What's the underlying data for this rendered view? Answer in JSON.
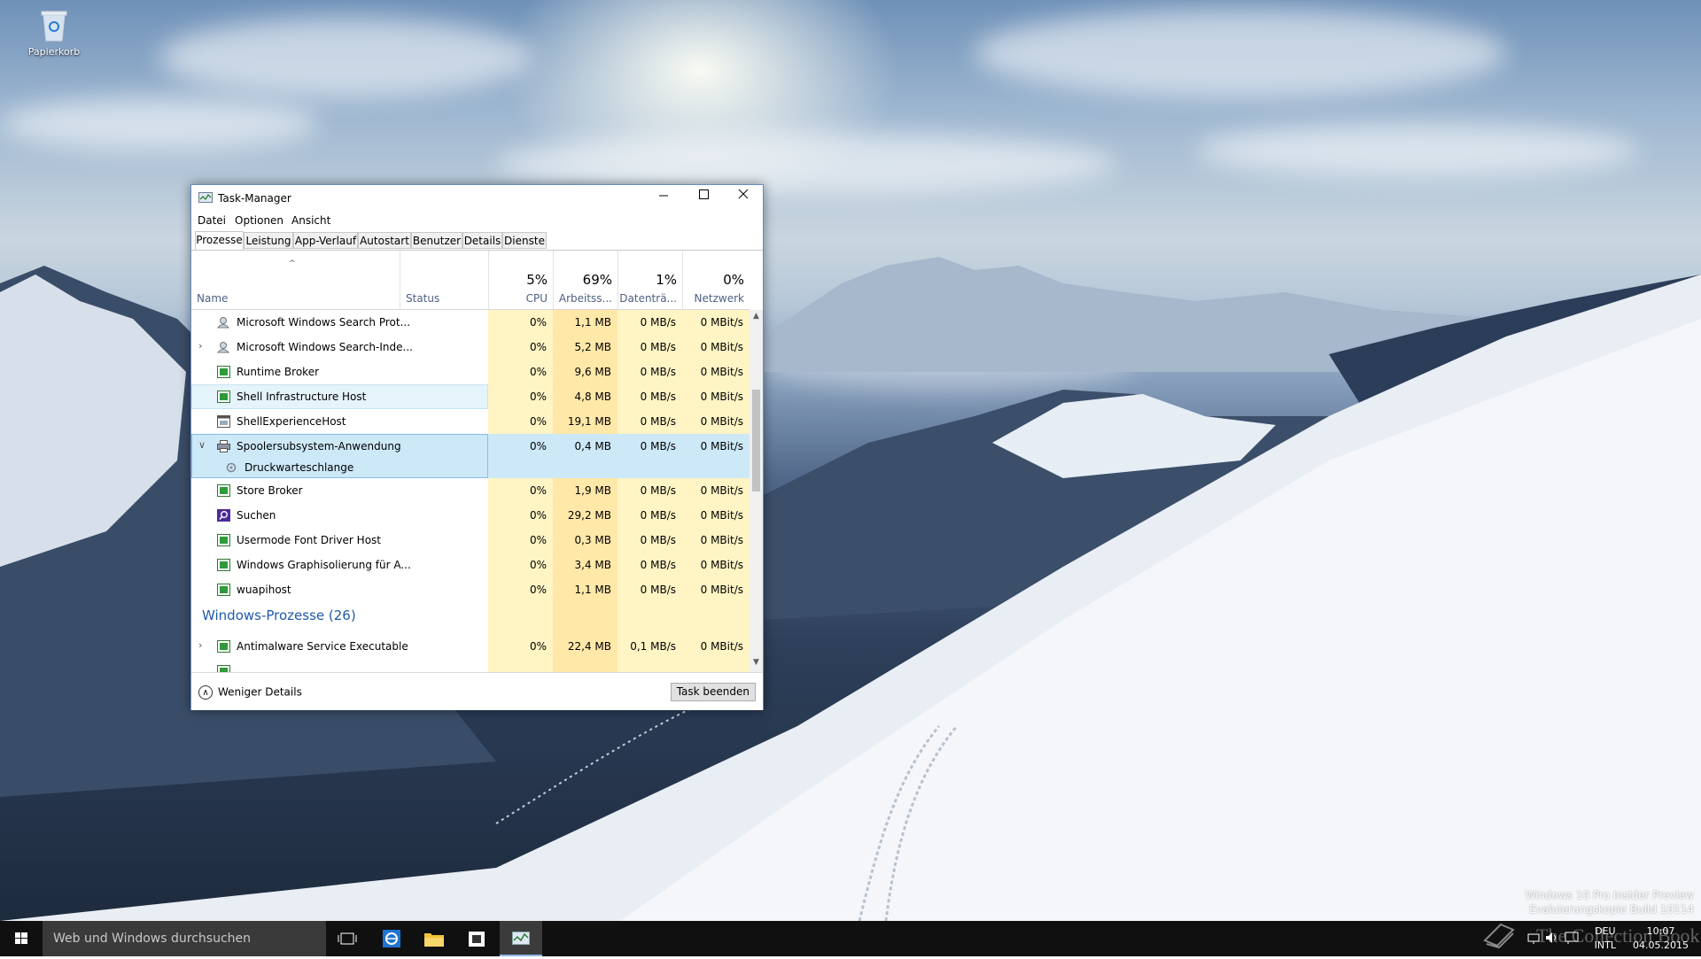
{
  "desktop": {
    "recycle_bin_label": "Papierkorb",
    "watermark_line1": "Windows 10 Pro Insider Preview",
    "watermark_line2": "Evaluierungskopie Build 10114",
    "publisher_mark": "The Collection Book"
  },
  "taskbar": {
    "search_placeholder": "Web und Windows durchsuchen",
    "lang_top": "DEU",
    "lang_bottom": "INTL",
    "time": "10:07",
    "date": "04.05.2015",
    "pinned": [
      "task-view-icon",
      "internet-explorer-icon",
      "file-explorer-icon",
      "store-icon",
      "task-manager-icon"
    ]
  },
  "window": {
    "title": "Task-Manager",
    "menu": [
      "Datei",
      "Optionen",
      "Ansicht"
    ],
    "tabs": [
      "Prozesse",
      "Leistung",
      "App-Verlauf",
      "Autostart",
      "Benutzer",
      "Details",
      "Dienste"
    ],
    "active_tab": "Prozesse",
    "columns": {
      "name": "Name",
      "status": "Status",
      "cpu_pct": "5%",
      "cpu": "CPU",
      "mem_pct": "69%",
      "mem": "Arbeitss...",
      "disk_pct": "1%",
      "disk": "Datenträ...",
      "net_pct": "0%",
      "net": "Netzwerk"
    },
    "rows": [
      {
        "name": "Microsoft Windows Search Prot...",
        "cpu": "0%",
        "mem": "1,1 MB",
        "disk": "0 MB/s",
        "net": "0 MBit/s",
        "icon": "search-service-icon"
      },
      {
        "name": "Microsoft Windows Search-Inde...",
        "cpu": "0%",
        "mem": "5,2 MB",
        "disk": "0 MB/s",
        "net": "0 MBit/s",
        "icon": "search-service-icon"
      },
      {
        "name": "Runtime Broker",
        "cpu": "0%",
        "mem": "9,6 MB",
        "disk": "0 MB/s",
        "net": "0 MBit/s",
        "icon": "process-icon"
      },
      {
        "name": "Shell Infrastructure Host",
        "cpu": "0%",
        "mem": "4,8 MB",
        "disk": "0 MB/s",
        "net": "0 MBit/s",
        "icon": "process-icon"
      },
      {
        "name": "ShellExperienceHost",
        "cpu": "0%",
        "mem": "19,1 MB",
        "disk": "0 MB/s",
        "net": "0 MBit/s",
        "icon": "window-process-icon"
      },
      {
        "name": "Spoolersubsystem-Anwendung",
        "cpu": "0%",
        "mem": "0,4 MB",
        "disk": "0 MB/s",
        "net": "0 MBit/s",
        "icon": "printer-icon"
      },
      {
        "name": "Druckwarteschlange",
        "icon": "service-gear-icon"
      },
      {
        "name": "Store Broker",
        "cpu": "0%",
        "mem": "1,9 MB",
        "disk": "0 MB/s",
        "net": "0 MBit/s",
        "icon": "process-icon"
      },
      {
        "name": "Suchen",
        "cpu": "0%",
        "mem": "29,2 MB",
        "disk": "0 MB/s",
        "net": "0 MBit/s",
        "icon": "cortana-search-icon"
      },
      {
        "name": "Usermode Font Driver Host",
        "cpu": "0%",
        "mem": "0,3 MB",
        "disk": "0 MB/s",
        "net": "0 MBit/s",
        "icon": "process-icon"
      },
      {
        "name": "Windows Graphisolierung für A...",
        "cpu": "0%",
        "mem": "3,4 MB",
        "disk": "0 MB/s",
        "net": "0 MBit/s",
        "icon": "process-icon"
      },
      {
        "name": "wuapihost",
        "cpu": "0%",
        "mem": "1,1 MB",
        "disk": "0 MB/s",
        "net": "0 MBit/s",
        "icon": "process-icon"
      },
      {
        "name": "Windows-Prozesse (26)"
      },
      {
        "name": "Antimalware Service Executable",
        "cpu": "0%",
        "mem": "22,4 MB",
        "disk": "0,1 MB/s",
        "net": "0 MBit/s",
        "icon": "process-icon"
      },
      {
        "name": "",
        "cpu": "",
        "mem": "",
        "disk": "",
        "net": ""
      }
    ],
    "footer": {
      "fewer_details": "Weniger Details",
      "end_task": "Task beenden"
    }
  }
}
